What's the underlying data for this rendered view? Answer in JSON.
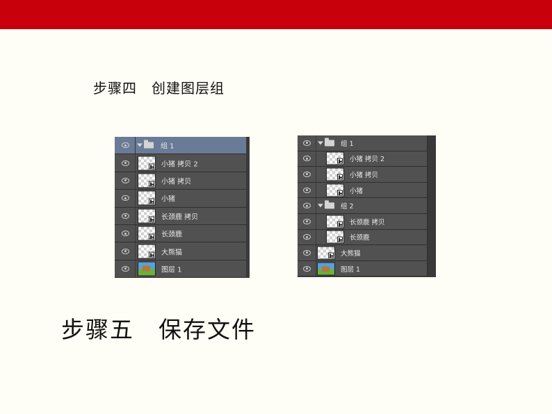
{
  "colors": {
    "accent_bar": "#c8000b",
    "page_bg": "#fffef6",
    "panel_bg": "#515151",
    "selected_row": "#6a7b97"
  },
  "heading_step4": "步骤四　创建图层组",
  "heading_step5": "步骤五　保存文件",
  "left_panel": {
    "rows": [
      {
        "type": "group",
        "label": "组 1",
        "selected": true,
        "icon": "folder-icon"
      },
      {
        "type": "layer",
        "label": "小猪 拷贝 2",
        "thumb": "transparent-smart-object"
      },
      {
        "type": "layer",
        "label": "小猪 拷贝",
        "thumb": "transparent-smart-object"
      },
      {
        "type": "layer",
        "label": "小猪",
        "thumb": "transparent-smart-object"
      },
      {
        "type": "layer",
        "label": "长颈鹿 拷贝",
        "thumb": "transparent-smart-object"
      },
      {
        "type": "layer",
        "label": "长颈鹿",
        "thumb": "transparent-smart-object"
      },
      {
        "type": "layer",
        "label": "大熊猫",
        "thumb": "transparent-smart-object"
      },
      {
        "type": "layer",
        "label": "图层 1",
        "thumb": "image"
      }
    ]
  },
  "right_panel": {
    "rows": [
      {
        "type": "group",
        "label": "组 1",
        "indent": 0,
        "icon": "folder-icon"
      },
      {
        "type": "layer",
        "label": "小猪 拷贝 2",
        "indent": 1,
        "thumb": "transparent-smart-object"
      },
      {
        "type": "layer",
        "label": "小猪 拷贝",
        "indent": 1,
        "thumb": "transparent-smart-object"
      },
      {
        "type": "layer",
        "label": "小猪",
        "indent": 1,
        "thumb": "transparent-smart-object"
      },
      {
        "type": "group",
        "label": "组 2",
        "indent": 0,
        "icon": "folder-icon"
      },
      {
        "type": "layer",
        "label": "长颈鹿 拷贝",
        "indent": 1,
        "thumb": "transparent-smart-object"
      },
      {
        "type": "layer",
        "label": "长颈鹿",
        "indent": 1,
        "thumb": "transparent-smart-object"
      },
      {
        "type": "layer",
        "label": "大熊猫",
        "indent": 0,
        "thumb": "transparent-smart-object"
      },
      {
        "type": "layer",
        "label": "图层 1",
        "indent": 0,
        "thumb": "image"
      }
    ]
  }
}
